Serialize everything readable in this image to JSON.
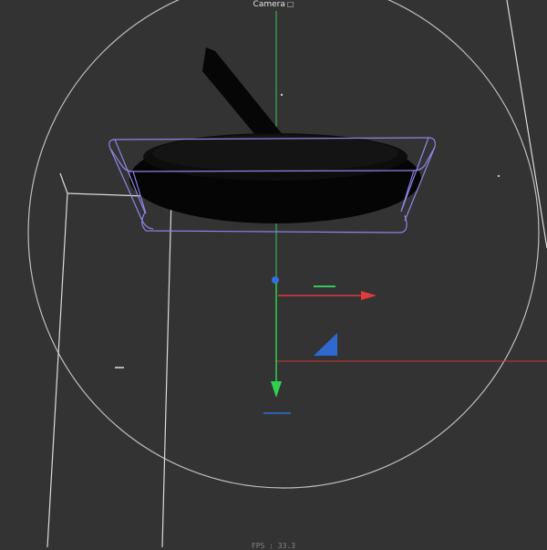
{
  "viewport": {
    "camera_label": "Camera",
    "camera_icon": "camera-icon",
    "fps_label": "FPS : 33.3"
  },
  "colors": {
    "background": "#333333",
    "guide_white": "#d8d8d8",
    "selection_box": "#8d86e6",
    "axis_x": "#e23b3b",
    "axis_y": "#2fd24f",
    "axis_z": "#2f6fe0",
    "object": "#050505"
  }
}
